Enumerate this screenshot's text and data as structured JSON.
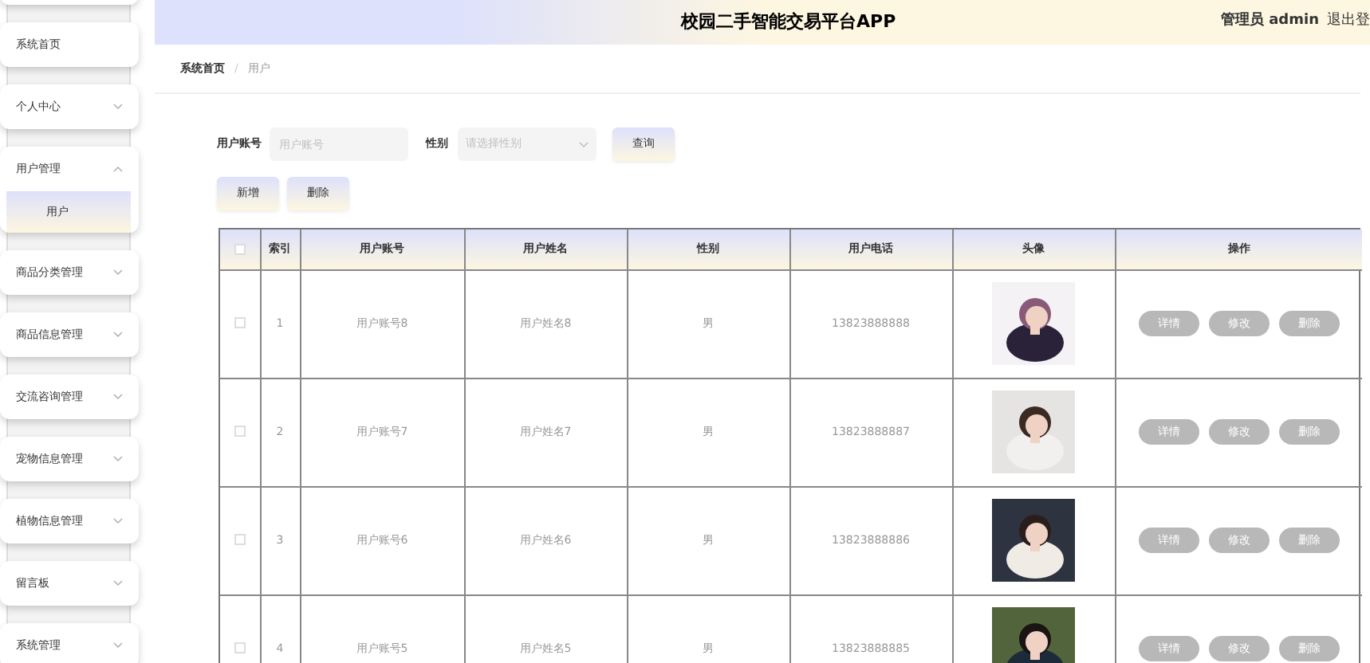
{
  "app_title": "校园二手智能交易平台APP",
  "user": {
    "role": "管理员",
    "name": "admin",
    "logout": "退出登"
  },
  "sidebar": {
    "items": [
      {
        "kind": "link",
        "label": "系统首页"
      },
      {
        "kind": "group",
        "label": "个人中心",
        "expanded": false
      },
      {
        "kind": "group",
        "label": "用户管理",
        "expanded": true,
        "children": [
          {
            "label": "用户",
            "selected": true
          }
        ]
      },
      {
        "kind": "group",
        "label": "商品分类管理",
        "expanded": false
      },
      {
        "kind": "group",
        "label": "商品信息管理",
        "expanded": false
      },
      {
        "kind": "group",
        "label": "交流咨询管理",
        "expanded": false
      },
      {
        "kind": "group",
        "label": "宠物信息管理",
        "expanded": false
      },
      {
        "kind": "group",
        "label": "植物信息管理",
        "expanded": false
      },
      {
        "kind": "group",
        "label": "留言板",
        "expanded": false
      },
      {
        "kind": "group",
        "label": "系统管理",
        "expanded": false
      }
    ]
  },
  "breadcrumb": {
    "items": [
      "系统首页",
      "用户"
    ],
    "separator": "/"
  },
  "search": {
    "account_label": "用户账号",
    "account_placeholder": "用户账号",
    "gender_label": "性别",
    "gender_placeholder": "请选择性别",
    "query_button": "查询"
  },
  "actions": [
    "新增",
    "删除"
  ],
  "table": {
    "columns": [
      "索引",
      "用户账号",
      "用户姓名",
      "性别",
      "用户电话",
      "头像",
      "操作"
    ],
    "all_checked": false,
    "rows": [
      {
        "index": "1",
        "account": "用户账号8",
        "name": "用户姓名8",
        "gender": "男",
        "phone": "13823888888",
        "avatar": {
          "kind": "picture"
        },
        "checked": false,
        "buttons": [
          "详情",
          "修改",
          "删除"
        ]
      },
      {
        "index": "2",
        "account": "用户账号7",
        "name": "用户姓名7",
        "gender": "男",
        "phone": "13823888887",
        "avatar": {
          "kind": "picture"
        },
        "checked": false,
        "buttons": [
          "详情",
          "修改",
          "删除"
        ]
      },
      {
        "index": "3",
        "account": "用户账号6",
        "name": "用户姓名6",
        "gender": "男",
        "phone": "13823888886",
        "avatar": {
          "kind": "picture"
        },
        "checked": false,
        "buttons": [
          "详情",
          "修改",
          "删除"
        ]
      },
      {
        "index": "4",
        "account": "用户账号5",
        "name": "用户姓名5",
        "gender": "男",
        "phone": "13823888885",
        "avatar": {
          "kind": "picture"
        },
        "checked": false,
        "buttons": [
          "详情",
          "修改",
          "删除"
        ]
      }
    ]
  }
}
